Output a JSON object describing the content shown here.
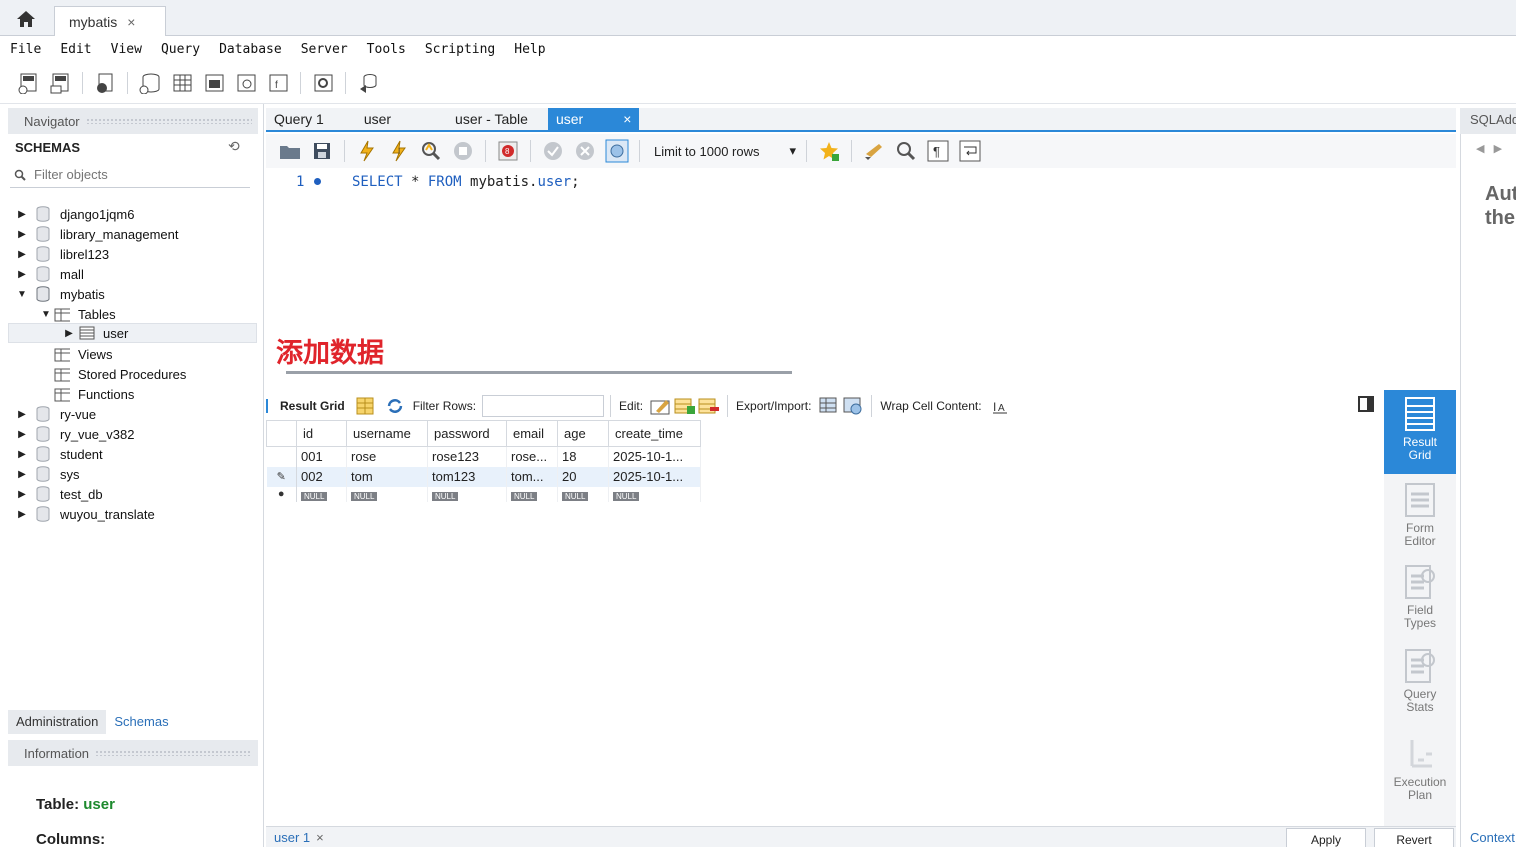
{
  "window": {
    "connection_tab": "mybatis",
    "close_glyph": "×"
  },
  "menu": [
    "File",
    "Edit",
    "View",
    "Query",
    "Database",
    "Server",
    "Tools",
    "Scripting",
    "Help"
  ],
  "navigator": {
    "header": "Navigator",
    "schemas_title": "SCHEMAS",
    "filter_placeholder": "Filter objects",
    "schemas": [
      "django1jqm6",
      "library_management",
      "librel123",
      "mall",
      "mybatis",
      "ry-vue",
      "ry_vue_v382",
      "student",
      "sys",
      "test_db",
      "wuyou_translate"
    ],
    "mybatis_children": {
      "tables_label": "Tables",
      "table_user": "user",
      "views": "Views",
      "procs": "Stored Procedures",
      "funcs": "Functions"
    },
    "bottom_tabs": [
      "Administration",
      "Schemas"
    ],
    "info_header": "Information",
    "info_table_label": "Table:",
    "info_table_value": "user",
    "info_columns_label": "Columns:"
  },
  "query_tabs": [
    "Query 1",
    "user",
    "user - Table",
    "user"
  ],
  "query_toolbar": {
    "limit": "Limit to 1000 rows"
  },
  "editor": {
    "line_number": "1",
    "kw_select": "SELECT",
    "star": " * ",
    "kw_from": "FROM",
    "schema": " mybatis.",
    "table": "user",
    "semi": ";"
  },
  "annotation": "添加数据",
  "result_toolbar": {
    "result_grid": "Result Grid",
    "filter_rows": "Filter Rows:",
    "edit": "Edit:",
    "export": "Export/Import:",
    "wrap": "Wrap Cell Content:"
  },
  "grid": {
    "columns": [
      "id",
      "username",
      "password",
      "email",
      "age",
      "create_time"
    ],
    "rows": [
      [
        "001",
        "rose",
        "rose123",
        "rose...",
        "18",
        "2025-10-1..."
      ],
      [
        "002",
        "tom",
        "tom123",
        "tom...",
        "20",
        "2025-10-1..."
      ]
    ],
    "null_label": "NULL"
  },
  "side_panel": {
    "result_grid": [
      "Result",
      "Grid"
    ],
    "form_editor": [
      "Form",
      "Editor"
    ],
    "field_types": [
      "Field",
      "Types"
    ],
    "query_stats": [
      "Query",
      "Stats"
    ],
    "exec_plan": [
      "Execution",
      "Plan"
    ]
  },
  "sql_additions": {
    "header": "SQLAdditions",
    "text_line1": "Aut",
    "text_line2": "the",
    "context": "Context"
  },
  "bottom": {
    "result_tab": "user 1",
    "apply": "Apply",
    "revert": "Revert"
  },
  "colors": {
    "accent": "#2b88d8",
    "annotation": "#e0242b",
    "table_value": "#1e8a2e"
  }
}
